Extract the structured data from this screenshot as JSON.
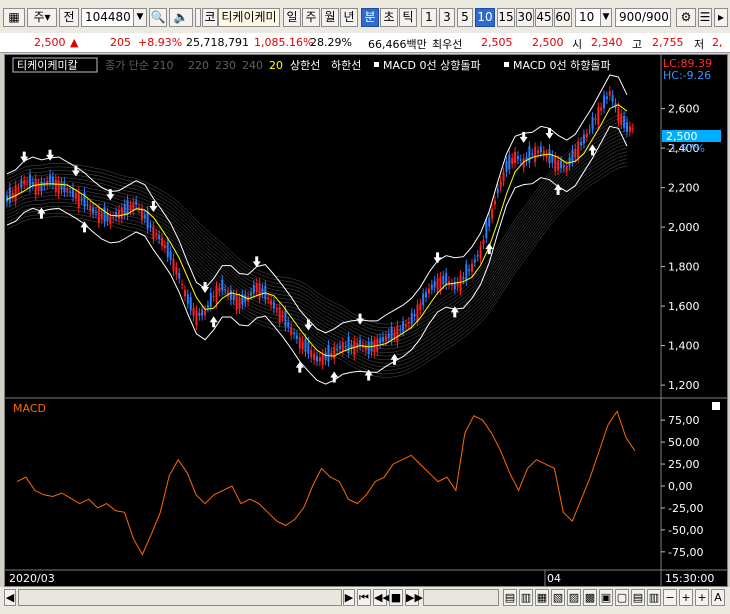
{
  "toolbar": {
    "mode": "주",
    "scope": "전",
    "code": "104480",
    "name_prefix": "코",
    "name": "티케이케미",
    "periods": [
      "일",
      "주",
      "월",
      "년"
    ],
    "sub_periods": [
      "분",
      "초",
      "틱"
    ],
    "intervals": [
      "1",
      "3",
      "5",
      "10",
      "15",
      "30",
      "45",
      "60"
    ],
    "selected_interval": "10",
    "count": "10",
    "range": "900/900"
  },
  "quote": {
    "price": "2,500",
    "arrow": "▲",
    "change": "205",
    "change_pct": "+8.93%",
    "volume": "25,718,791",
    "vol_ratio": "1,085.16%",
    "turnover": "28.29%",
    "amount": "66,466백만",
    "best_label": "최우선",
    "best_ask": "2,505",
    "best_bid": "2,500",
    "open_label": "시",
    "open": "2,340",
    "high_label": "고",
    "high": "2,755",
    "low_label": "저",
    "low": "2,"
  },
  "legend": {
    "title": "티케이케미칼",
    "items": [
      "종가 단순 210",
      "220",
      "230",
      "240",
      "20",
      "상한선",
      "하한선",
      "MACD 0선 상향돌파",
      "MACD 0선 하향돌파"
    ],
    "lc": "LC:89.39",
    "hc": "HC:-9.26"
  },
  "price_axis": {
    "ticks": [
      "2,600",
      "2,400",
      "2,200",
      "2,000",
      "1,800",
      "1,600",
      "1,400",
      "1,200"
    ],
    "current": "2,500",
    "current_pct": "-1.57%"
  },
  "macd_panel": {
    "title": "MACD",
    "ticks": [
      "75,00",
      "50,00",
      "25,00",
      "0,00",
      "-25,00",
      "-50,00",
      "-75,00"
    ]
  },
  "time_axis": {
    "start": "2020/03",
    "mid": "04",
    "end": "15:30:00"
  },
  "colors": {
    "price_up": "#ff0000",
    "price_down": "#0000ff",
    "macd_line": "#ff6a00",
    "ma_yellow": "#ffff00",
    "band": "#ffffff"
  },
  "chart_data": {
    "type": "line",
    "title": "티케이케미칼",
    "ylim": [
      1200,
      2700
    ],
    "price_path": [
      2140,
      2180,
      2230,
      2220,
      2200,
      2240,
      2210,
      2190,
      2160,
      2130,
      2080,
      2060,
      2040,
      2070,
      2090,
      2120,
      2050,
      1980,
      1930,
      1850,
      1750,
      1630,
      1550,
      1570,
      1650,
      1700,
      1650,
      1620,
      1640,
      1700,
      1660,
      1600,
      1550,
      1480,
      1420,
      1380,
      1330,
      1340,
      1370,
      1400,
      1390,
      1410,
      1380,
      1410,
      1440,
      1460,
      1490,
      1530,
      1600,
      1680,
      1720,
      1730,
      1700,
      1740,
      1800,
      1880,
      2020,
      2180,
      2300,
      2360,
      2330,
      2370,
      2390,
      2350,
      2320,
      2300,
      2380,
      2440,
      2520,
      2600,
      2680,
      2580,
      2500
    ],
    "macd_ylim": [
      -90,
      90
    ],
    "macd_values": [
      5,
      10,
      -5,
      -10,
      -12,
      -8,
      -14,
      -20,
      -15,
      -25,
      -20,
      -28,
      -30,
      -60,
      -78,
      -55,
      -30,
      12,
      30,
      15,
      -10,
      -20,
      -10,
      -5,
      0,
      -20,
      -15,
      -20,
      -30,
      -40,
      -45,
      -38,
      -25,
      0,
      20,
      10,
      5,
      -15,
      -20,
      -10,
      5,
      10,
      25,
      30,
      35,
      25,
      15,
      5,
      10,
      -5,
      60,
      80,
      75,
      60,
      40,
      15,
      -5,
      20,
      30,
      25,
      20,
      -30,
      -40,
      -15,
      10,
      40,
      70,
      85,
      55,
      40
    ]
  }
}
